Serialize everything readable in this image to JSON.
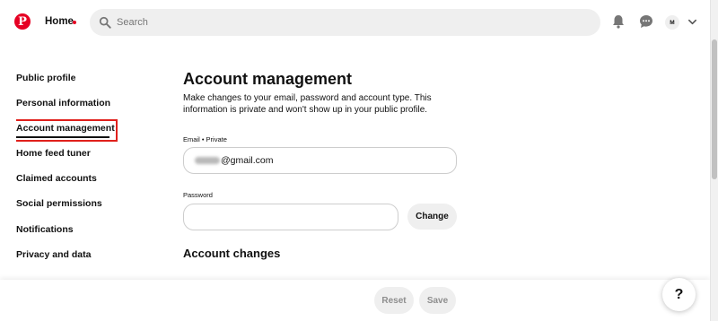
{
  "header": {
    "logo_letter": "P",
    "home_label": "Home",
    "search_placeholder": "Search",
    "avatar_initial": "M"
  },
  "sidebar": {
    "items": [
      {
        "label": "Public profile"
      },
      {
        "label": "Personal information"
      },
      {
        "label": "Account management",
        "active": true
      },
      {
        "label": "Home feed tuner"
      },
      {
        "label": "Claimed accounts"
      },
      {
        "label": "Social permissions"
      },
      {
        "label": "Notifications"
      },
      {
        "label": "Privacy and data"
      }
    ]
  },
  "main": {
    "title": "Account management",
    "description": "Make changes to your email, password and account type. This information is private and won't show up in your public profile.",
    "email": {
      "label": "Email • Private",
      "value_suffix": "@gmail.com"
    },
    "password": {
      "label": "Password",
      "value": ""
    },
    "change_button": "Change",
    "section_title": "Account changes"
  },
  "footer": {
    "reset_label": "Reset",
    "save_label": "Save",
    "help_label": "?"
  },
  "colors": {
    "brand": "#e60023",
    "highlight_box": "#e0201c"
  }
}
